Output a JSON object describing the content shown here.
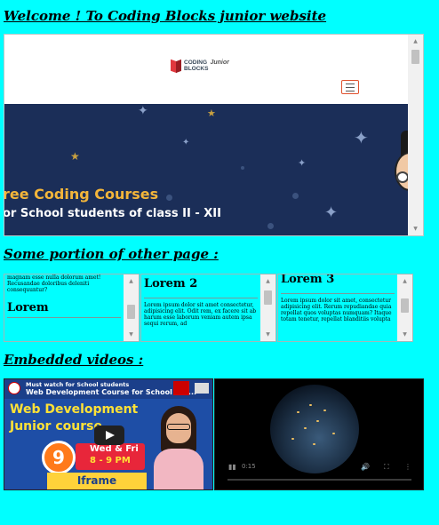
{
  "headings": {
    "welcome": "Welcome ! To Coding Blocks junior website",
    "portion": "Some portion of other page :",
    "videos": "Embedded videos :"
  },
  "site": {
    "logo_line1": "CODING",
    "logo_line2": "BLOCKS",
    "logo_tag": "Junior",
    "banner_title": "ree Coding Courses",
    "banner_subtitle": "or School students of class II - XII",
    "colors": {
      "banner": "#1b2e58",
      "title": "#f3b53a"
    }
  },
  "minis": [
    {
      "top_text": "magnam esse nulla dolorum amet! Recusandae doloribus deleniti consequuntur?",
      "title": "Lorem"
    },
    {
      "title": "Lorem 2",
      "body": "Lorem ipsum dolor sit amet consectetur, adipisicing elit. Odit rem, ex facere sit ab harum esse laborum veniam autem ipsa sequi rerum, ad"
    },
    {
      "title": "Lorem 3",
      "body": "Lorem ipsum dolor sit amet, consectetur adipisicing elit. Rerum repudiandae quia repellat quos voluptas numquam? Itaque totam tenetur, repellat blanditiis volupta"
    }
  ],
  "video1": {
    "must_watch": "Must watch for School students",
    "title": "Web Development Course for School Stu...",
    "line1": "Web Development",
    "line2": "Junior course",
    "number": "9",
    "days": "Wed & Fri",
    "time": "8 - 9 PM",
    "label": "Iframe"
  },
  "video2": {
    "time": "0:15",
    "play_icon": "▮▮",
    "vol_icon": "🔊",
    "fs_icon": "⛶",
    "more_icon": "⋮"
  }
}
